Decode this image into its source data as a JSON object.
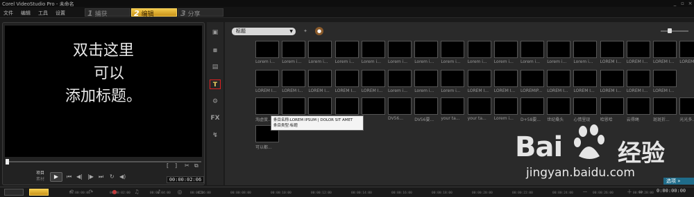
{
  "window": {
    "title": "Corel VideoStudio Pro - 未命名"
  },
  "menu": [
    "文件",
    "编辑",
    "工具",
    "设置"
  ],
  "steps": [
    {
      "n": "1",
      "label": "捕获"
    },
    {
      "n": "2",
      "label": "编辑"
    },
    {
      "n": "3",
      "label": "分享"
    }
  ],
  "preview": {
    "caption_lines": [
      "双击这里",
      "可以",
      "添加标题。"
    ],
    "project_label": "项目",
    "clip_label": "素材",
    "timecode": "00:00:02:06"
  },
  "tools": [
    {
      "icon": "media-icon"
    },
    {
      "icon": "transition-icon"
    },
    {
      "icon": "graphic-icon"
    },
    {
      "icon": "title-icon",
      "label": "T"
    },
    {
      "icon": "instant-project-icon"
    },
    {
      "icon": "filter-icon",
      "label": "FX"
    },
    {
      "icon": "path-icon"
    }
  ],
  "library": {
    "category": "标题",
    "thumbs_row1": [
      "Lorem i...",
      "Lorem i...",
      "Lorem i...",
      "Lorem i...",
      "Lorem i...",
      "Lorem i...",
      "Lorem i...",
      "Lorem i...",
      "Lorem i...",
      "Lorem i...",
      "Lorem i...",
      "Lorem i...",
      "Lorem i...",
      "LOREM I...",
      "LOREM I...",
      "LOREM I...",
      "LOREM I..."
    ],
    "thumbs_row2": [
      "LOREM I...",
      "LOREM I...",
      "LOREM I...",
      "LOREM I...",
      "LOREM I...",
      "Lorem i...",
      "Lorem i...",
      "Lorem i...",
      "LOREM I...",
      "LOREM I...",
      "LOREMIP...",
      "LOREM I...",
      "LOREM I...",
      "LOREM I...",
      "LOREM I...",
      "LOREM I..."
    ],
    "thumbs_row3": [
      "淘虚度...",
      "http:...",
      "",
      "",
      "",
      "DV56...",
      "DV56要...",
      "your ta...",
      "your ta...",
      "Lorem i...",
      "D+58要...",
      "世纪桑头",
      "心情里现",
      "哈恩哈",
      "云得绳",
      "斑斑折...",
      "光光多..."
    ],
    "thumbs_row4": [
      "可以都..."
    ],
    "tooltip_line1": "条目名称:LOREM IPSUM | DOLOR SIT AMET",
    "tooltip_line2": "条目类型:标题",
    "options_label": "选项"
  },
  "timeline": {
    "timecode": "0:00:00:00",
    "ruler": [
      "00:00:00:00",
      "00:00:02:00",
      "00:00:04:00",
      "00:00:06:00",
      "00:00:08:00",
      "00:00:10:00",
      "00:00:12:00",
      "00:00:14:00",
      "00:00:16:00",
      "00:00:18:00",
      "00:00:20:00",
      "00:00:22:00",
      "00:00:24:00",
      "00:00:26:00",
      "00:00:28:00"
    ]
  },
  "watermark": {
    "brand": "Bai",
    "brand2": "经验",
    "url": "jingyan.baidu.com"
  },
  "colors": {
    "accent": "#e8b02e",
    "highlight_box": "#e02020",
    "options": "#1f6c8a"
  }
}
